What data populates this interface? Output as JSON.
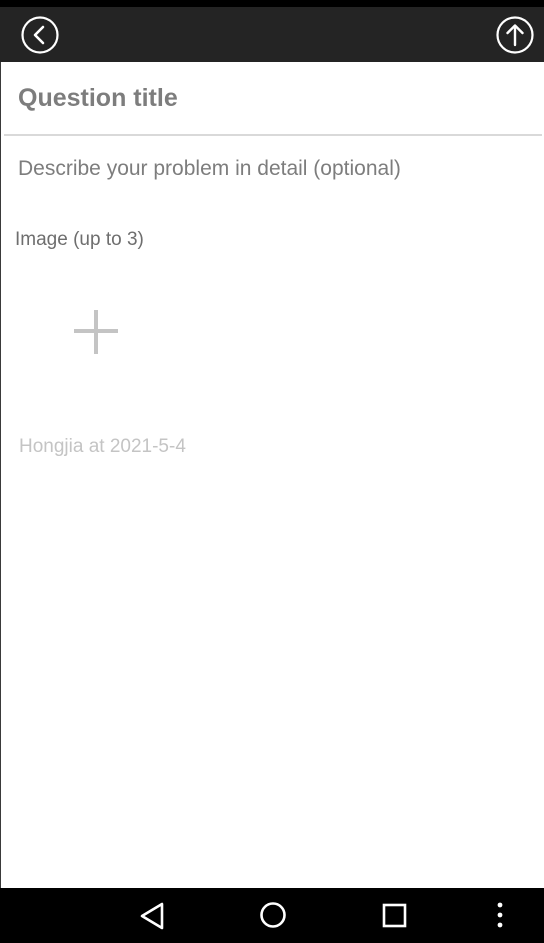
{
  "toolbar": {
    "back_icon": "circle-arrow-left-icon",
    "submit_icon": "circle-arrow-up-icon",
    "background_color": "#242424"
  },
  "form": {
    "title_placeholder": "Question title",
    "title_value": "",
    "description_placeholder": "Describe your problem in detail (optional)",
    "description_value": "",
    "image_label": "Image (up to 3)",
    "add_image_icon": "plus-icon",
    "signature": "Hongjia at 2021-5-4"
  },
  "navigation_bar": {
    "icons": [
      "back-triangle-icon",
      "home-circle-icon",
      "recents-square-icon",
      "more-vert-icon"
    ]
  }
}
